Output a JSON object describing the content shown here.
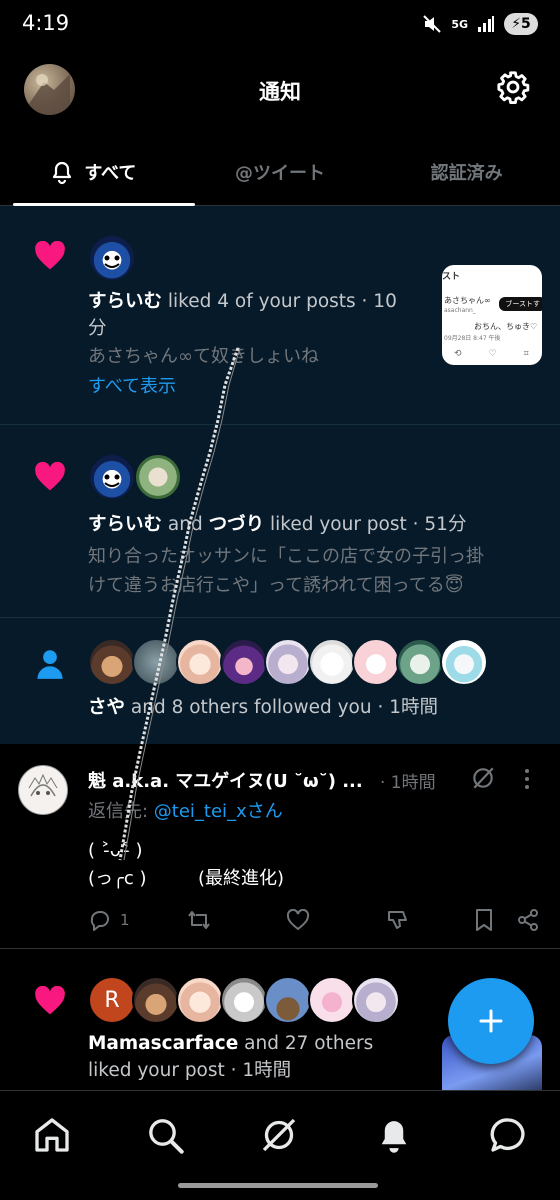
{
  "status_bar": {
    "time": "4:19",
    "network": "5G",
    "battery": "5"
  },
  "header": {
    "title": "通知"
  },
  "tabs": [
    {
      "label": "すべて",
      "active": true
    },
    {
      "label": "@ツイート",
      "active": false
    },
    {
      "label": "認証済み",
      "active": false
    }
  ],
  "notifications": {
    "n1": {
      "user": "すらいむ",
      "action": " liked 4 of your posts · 10",
      "action_wrap": "分",
      "preview": "あさちゃん∞て奴きしょいね",
      "show_all": "すべて表示",
      "thumb": {
        "header": "スト",
        "name": "あさちゃん∞",
        "handle": "asachann_",
        "boost": "ブーストす",
        "text": "おちん、ちゅき♡",
        "date": "09月28日 8:47 午後"
      }
    },
    "n2": {
      "user1": "すらいむ",
      "and": " and ",
      "user2": "つづり",
      "action": " liked your post · 51分",
      "preview_line1": "知り合ったオッサンに「ここの店で女の子引っ掛",
      "preview_line2": "けて違うお店行こや」って誘われて困ってる😇"
    },
    "n3": {
      "user": "さや",
      "action": " and 8 others followed you · 1時間"
    },
    "n4": {
      "user": "Mamascarface",
      "action": " and 27 others",
      "action_line2": "liked your post · 1時間",
      "first_avatar_letter": "R"
    }
  },
  "tweet": {
    "name": "魁 a.k.a. マユゲイヌ(U ˘ω˘) ...",
    "time": "· 1時間",
    "reply_prefix": "返信先: ",
    "reply_to": "@tei_tei_xさん",
    "body": "( ˃̵ᴗ˂̵ )\n(っ╭c )         (最終進化)",
    "reply_count": "1"
  },
  "colors": {
    "accent_blue": "#1d9bf0",
    "like_pink": "#f91880",
    "highlight_bg": "#061a2a"
  }
}
